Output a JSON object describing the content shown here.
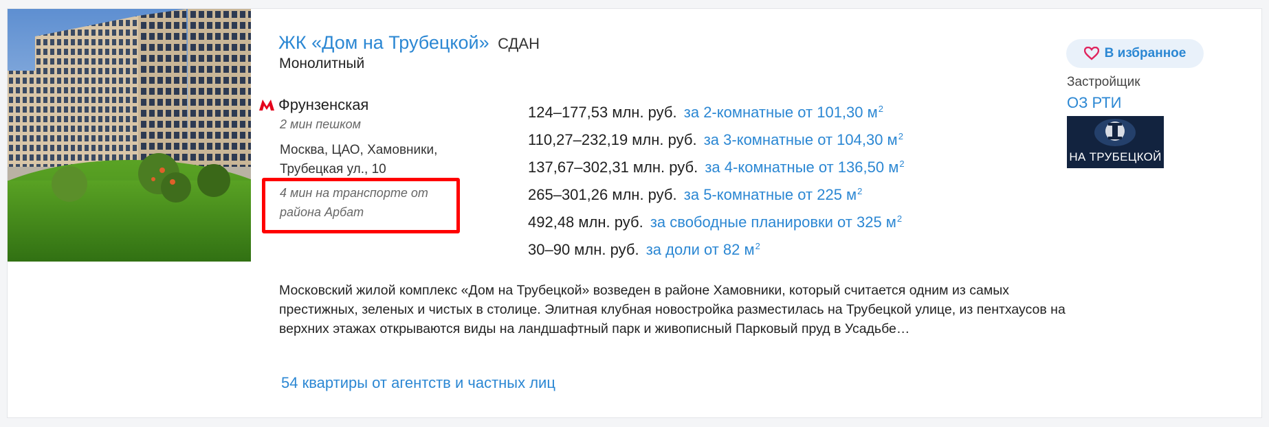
{
  "listing": {
    "title": "ЖК «Дом на Трубецкой»",
    "status": "СДАН",
    "construction": "Монолитный",
    "metro": {
      "icon": "metro-m-icon",
      "color": "#e4001b",
      "station": "Фрунзенская",
      "walk": "2 мин пешком"
    },
    "address": "Москва, ЦАО, Хамовники, Трубецкая ул., 10",
    "transport": "4 мин на транспорте от района Арбат",
    "prices": [
      {
        "range": "124–177,53 млн. руб.",
        "label": "за 2-комнатные от 101,30 м",
        "sup": "2"
      },
      {
        "range": "110,27–232,19 млн. руб.",
        "label": "за 3-комнатные от 104,30 м",
        "sup": "2"
      },
      {
        "range": "137,67–302,31 млн. руб.",
        "label": "за 4-комнатные от 136,50 м",
        "sup": "2"
      },
      {
        "range": "265–301,26 млн. руб.",
        "label": "за 5-комнатные от 225 м",
        "sup": "2"
      },
      {
        "range": "492,48 млн. руб.",
        "label": "за свободные планировки от 325 м",
        "sup": "2"
      },
      {
        "range": "30–90 млн. руб.",
        "label": "за доли от 82 м",
        "sup": "2"
      }
    ],
    "description": "Московский жилой комплекс «Дом на Трубецкой» возведен в районе Хамовники, который считается одним из самых престижных, зеленых и чистых в столице. Элитная клубная новостройка разместилась на Трубецкой улице, из пентхаусов на верхних этажах открываются виды на ландшафтный парк и живописный Парковый пруд в Усадьбе…",
    "offers_link": "54 квартиры от агентств и частных лиц"
  },
  "sidebar": {
    "favorite_label": "В избранное",
    "favorite_icon": "heart-icon",
    "developer_label": "Застройщик",
    "developer_name": "ОЗ РТИ",
    "developer_logo_text": "НА ТРУБЕЦКОЙ"
  },
  "colors": {
    "accent": "#2b87d3",
    "highlight_border": "#ff0000",
    "button_bg": "#e9f1fa"
  }
}
